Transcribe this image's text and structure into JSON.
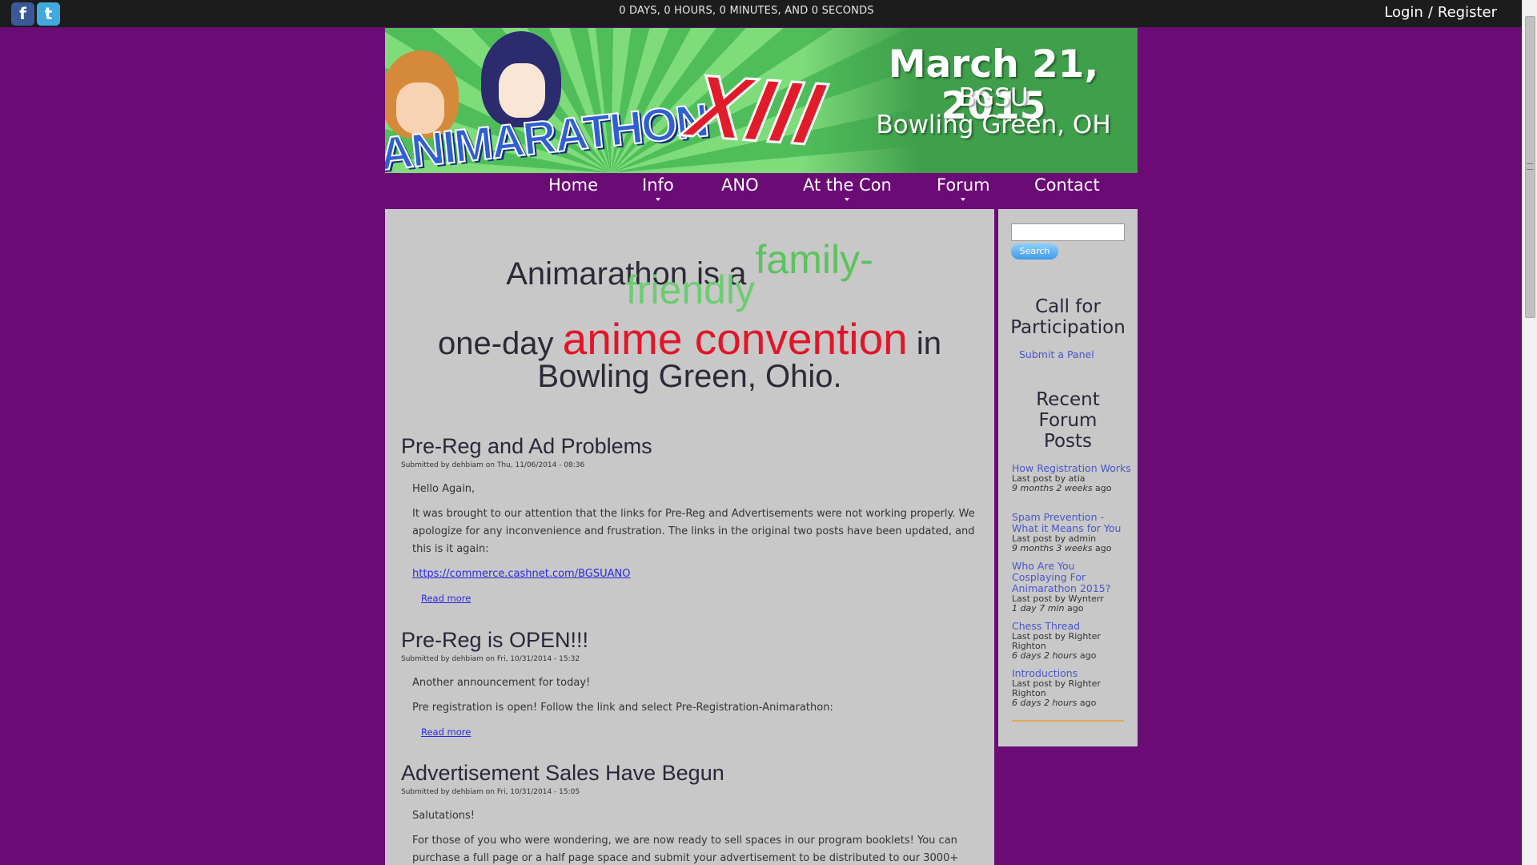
{
  "topbar": {
    "countdown": "0 DAYS, 0 HOURS, 0 MINUTES, AND 0 SECONDS",
    "login": "Login",
    "sep": "/",
    "register": "Register",
    "social": [
      "facebook-icon",
      "twitter-icon"
    ]
  },
  "banner": {
    "logo_text": "ANIMARATHON",
    "logo_num": "XIII",
    "date": "March 21, 2015",
    "venue": "BGSU",
    "city": "Bowling Green, OH"
  },
  "nav": {
    "items": [
      {
        "label": "Home"
      },
      {
        "label": "Info"
      },
      {
        "label": "ANO"
      },
      {
        "label": "At the Con"
      },
      {
        "label": "Forum"
      },
      {
        "label": "Contact"
      }
    ]
  },
  "tagline": {
    "p1": "Animarathon is a ",
    "fam": "family-",
    "fr": "friendly",
    "p2": "one-day ",
    "con": "anime convention",
    "p3": " in",
    "p4": "Bowling Green, Ohio."
  },
  "posts": [
    {
      "title": "Pre-Reg and Ad Problems",
      "meta": "Submitted by dehbiam on Thu, 11/06/2014 - 08:36",
      "p1": "Hello Again,",
      "p2": "It was brought to our attention that the links for Pre-Reg and Advertisements were not working properly. We apologize for any inconvenience and frustration. The links in the original two posts have been updated, and this is it again:",
      "link": "https://commerce.cashnet.com/BGSUANO",
      "more": "Read more"
    },
    {
      "title": "Pre-Reg is OPEN!!!",
      "meta": "Submitted by dehbiam on Fri, 10/31/2014 - 15:32",
      "p1": "Another announcement for today!",
      "p2": "Pre registration is open! Follow the link and select Pre-Registration-Animarathon:",
      "more": "Read more"
    },
    {
      "title": "Advertisement Sales Have Begun",
      "meta": "Submitted by dehbiam on Fri, 10/31/2014 - 15:05",
      "p1": "Salutations!",
      "p2": "For those of you who were wondering, we are now ready to sell spaces in our program booklets! You can purchase a full page or a half page space and submit your advertisement to be distributed to our 3000+"
    }
  ],
  "sidebar": {
    "search_button": "Search",
    "cfp_title": "Call for Participation",
    "cfp_link": "Submit a Panel",
    "forum_title": "Recent Forum Posts",
    "forum": [
      {
        "title": "How Registration Works",
        "by": "Last post by atia",
        "ago": "9 months 2 weeks",
        "suffix": " ago"
      },
      {
        "title": "Spam Prevention - What it Means for You",
        "by": "Last post by admin",
        "ago": "9 months 3 weeks",
        "suffix": " ago"
      },
      {
        "title": "Who Are You Cosplaying For Animarathon 2015?",
        "by": "Last post by Wynterr",
        "ago": "1 day 7 min",
        "suffix": " ago"
      },
      {
        "title": "Chess Thread",
        "by": "Last post by Righter Righton",
        "ago": "6 days 2 hours",
        "suffix": " ago"
      },
      {
        "title": "Introductions",
        "by": "Last post by Righter Righton",
        "ago": "6 days 2 hours",
        "suffix": " ago"
      }
    ]
  },
  "colors": {
    "background": "#6a0b76",
    "accent_green": "#5cc35e",
    "accent_red": "#e21528",
    "link_blue": "#4a56c8"
  }
}
